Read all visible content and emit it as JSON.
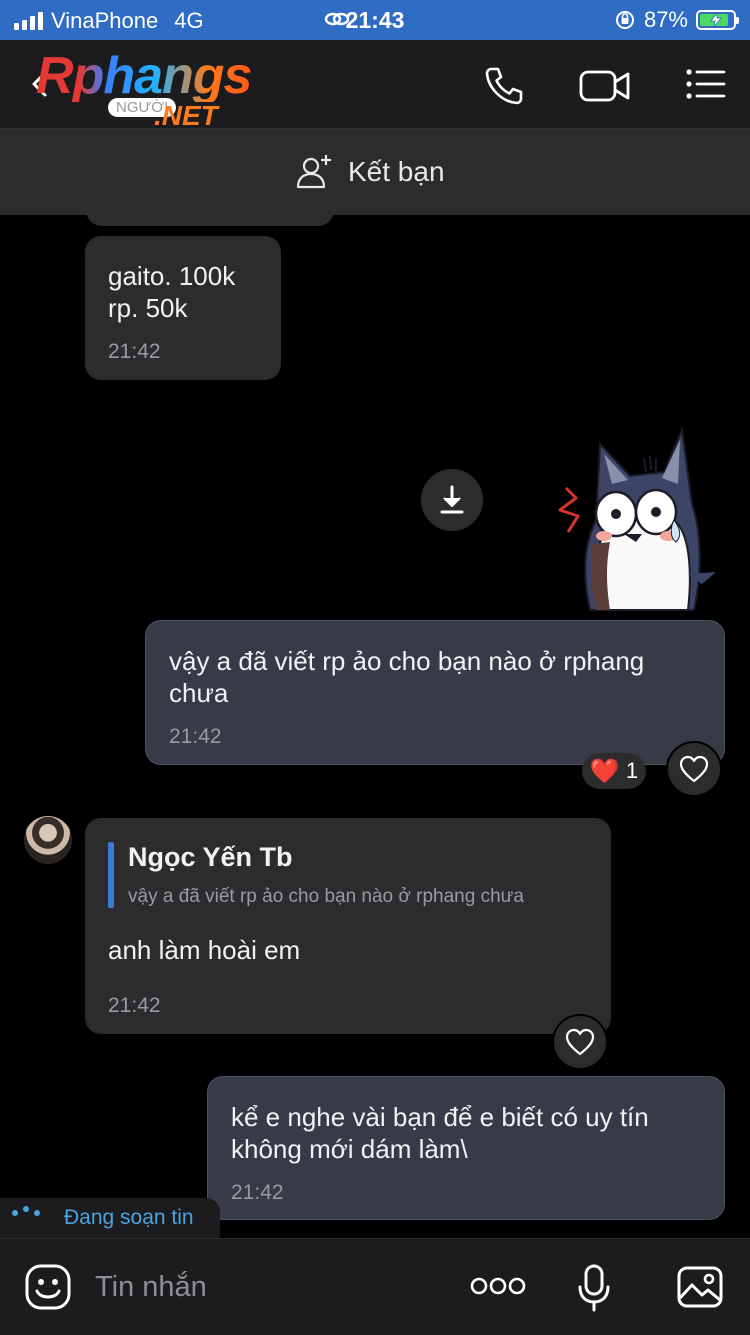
{
  "status_bar": {
    "carrier": "VinaPhone",
    "network": "4G",
    "time": "21:43",
    "battery_percent": "87%",
    "battery_level": 0.87
  },
  "header": {
    "logo_main": "Rphangs",
    "logo_tag": "NGƯỜI",
    "logo_suffix": ".NET",
    "icons": [
      "back-icon",
      "phone-icon",
      "video-call-icon",
      "menu-list-icon"
    ]
  },
  "friend_bar": {
    "label": "Kết bạn",
    "icon": "add-friend-icon"
  },
  "messages": [
    {
      "id": "m1",
      "direction": "in",
      "lines": [
        "gaito. 100k",
        "rp. 50k"
      ],
      "time": "21:42"
    },
    {
      "id": "m2",
      "direction": "out",
      "type": "sticker",
      "sticker": "shocked-fox-sticker"
    },
    {
      "id": "m3",
      "direction": "out",
      "text": "vậy a đã viết rp ảo cho bạn nào ở rphang chưa",
      "time": "21:42",
      "reaction": {
        "emoji": "❤️",
        "count": "1"
      }
    },
    {
      "id": "m4",
      "direction": "in",
      "quote_author": "Ngọc Yến Tb",
      "quote_text": "vậy a đã viết rp ảo cho bạn nào ở rphang chưa",
      "text": "anh làm hoài em",
      "time": "21:42"
    },
    {
      "id": "m5",
      "direction": "out",
      "text": "kể e nghe vài bạn để e biết có uy tín không mới dám làm\\",
      "time": "21:42"
    }
  ],
  "typing_indicator": "Đang soạn tin",
  "input_bar": {
    "placeholder": "Tin nhắn",
    "icons": [
      "emoji-icon",
      "more-options-icon",
      "microphone-icon",
      "image-icon"
    ]
  },
  "colors": {
    "status_bar": "#2F6CC3",
    "background": "#000000",
    "incoming_bubble": "#2c2c2e",
    "outgoing_bubble": "#363b47",
    "accent": "#3a7bd5"
  }
}
